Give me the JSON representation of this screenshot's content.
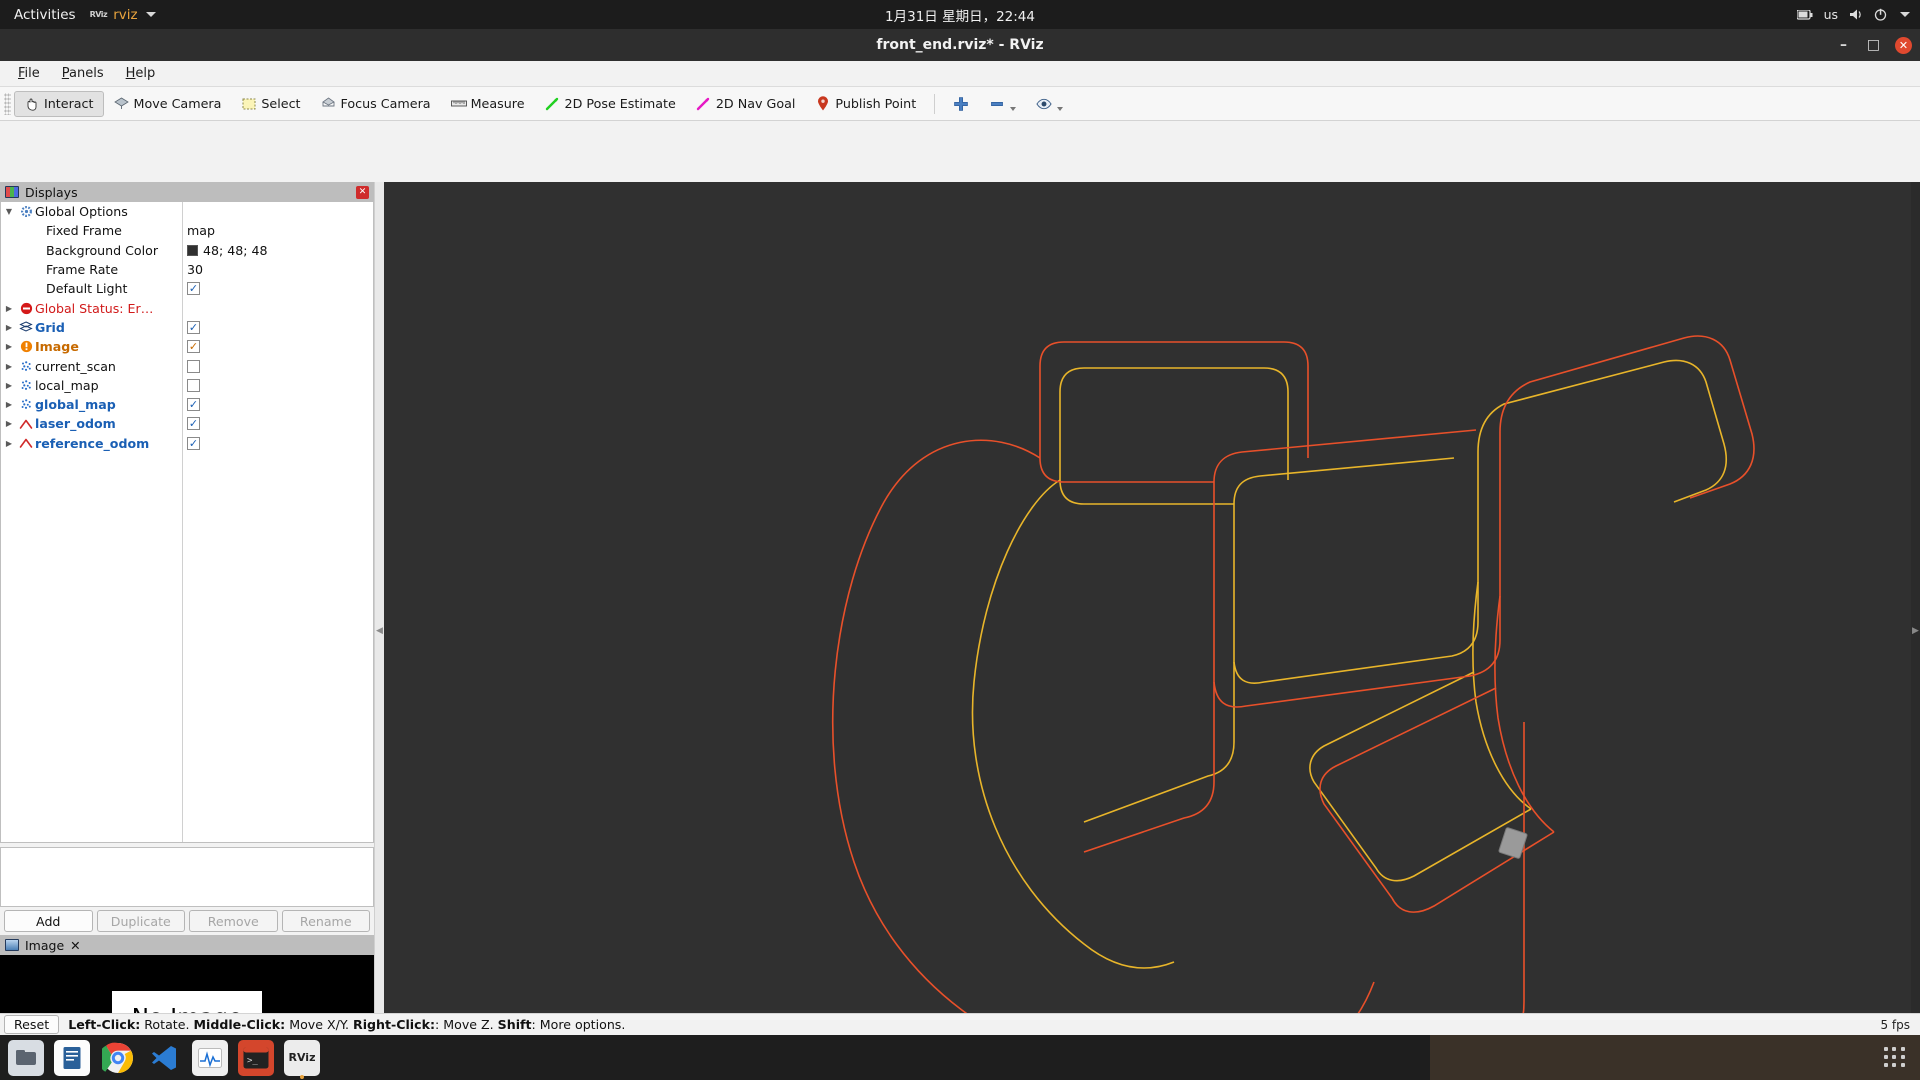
{
  "gnome": {
    "activities": "Activities",
    "app_icon_text": "RViz",
    "app_name": "rviz",
    "datetime": "1月31日 星期日，22:44",
    "keyboard_layout": "us",
    "icons": [
      "battery-icon",
      "keyboard-icon",
      "volume-icon",
      "power-icon",
      "chevron-down-icon"
    ]
  },
  "window": {
    "title": "front_end.rviz* - RViz",
    "minimize": "–",
    "maximize": "□",
    "close": "✕"
  },
  "menubar": {
    "items": [
      {
        "label": "File",
        "accel": "F"
      },
      {
        "label": "Panels",
        "accel": "P"
      },
      {
        "label": "Help",
        "accel": "H"
      }
    ]
  },
  "toolbar": {
    "buttons": [
      {
        "label": "Interact",
        "icon": "hand-icon",
        "active": true
      },
      {
        "label": "Move Camera",
        "icon": "move-camera-icon",
        "active": false
      },
      {
        "label": "Select",
        "icon": "select-rect-icon",
        "active": false
      },
      {
        "label": "Focus Camera",
        "icon": "focus-camera-icon",
        "active": false
      },
      {
        "label": "Measure",
        "icon": "ruler-icon",
        "active": false
      },
      {
        "label": "2D Pose Estimate",
        "icon": "green-arrow-icon",
        "active": false
      },
      {
        "label": "2D Nav Goal",
        "icon": "magenta-arrow-icon",
        "active": false
      },
      {
        "label": "Publish Point",
        "icon": "map-pin-icon",
        "active": false
      }
    ],
    "extra_icons": [
      {
        "name": "plus-icon",
        "glyph": "✚"
      },
      {
        "name": "minus-icon",
        "glyph": "➖"
      },
      {
        "name": "eye-icon",
        "glyph": "👁"
      }
    ]
  },
  "displays_panel": {
    "title": "Displays",
    "close_glyph": "✕",
    "tree": [
      {
        "label": "Global Options",
        "icon": "gear-icon",
        "style": "plain",
        "arrow": "down",
        "indent": 0,
        "value": "",
        "check": null
      },
      {
        "label": "Fixed Frame",
        "icon": "",
        "style": "plain",
        "arrow": "",
        "indent": 1,
        "value": "map",
        "check": null
      },
      {
        "label": "Background Color",
        "icon": "",
        "style": "plain",
        "arrow": "",
        "indent": 1,
        "value": "48; 48; 48",
        "swatch": "#303030",
        "check": null
      },
      {
        "label": "Frame Rate",
        "icon": "",
        "style": "plain",
        "arrow": "",
        "indent": 1,
        "value": "30",
        "check": null
      },
      {
        "label": "Default Light",
        "icon": "",
        "style": "plain",
        "arrow": "",
        "indent": 1,
        "value": "",
        "check": true,
        "check_color": "blue"
      },
      {
        "label": "Global Status: Er…",
        "icon": "error-icon",
        "style": "red",
        "arrow": "right",
        "indent": 0,
        "value": "",
        "check": null
      },
      {
        "label": "Grid",
        "icon": "grid-icon",
        "style": "blue",
        "arrow": "right",
        "indent": 0,
        "value": "",
        "check": true,
        "check_color": "blue"
      },
      {
        "label": "Image",
        "icon": "warning-icon",
        "style": "orange",
        "arrow": "right",
        "indent": 0,
        "value": "",
        "check": true,
        "check_color": "orange"
      },
      {
        "label": "current_scan",
        "icon": "pointcloud-icon",
        "style": "plain",
        "arrow": "right",
        "indent": 0,
        "value": "",
        "check": false
      },
      {
        "label": "local_map",
        "icon": "pointcloud-icon",
        "style": "plain",
        "arrow": "right",
        "indent": 0,
        "value": "",
        "check": false
      },
      {
        "label": "global_map",
        "icon": "pointcloud-icon",
        "style": "blue",
        "arrow": "right",
        "indent": 0,
        "value": "",
        "check": true,
        "check_color": "blue"
      },
      {
        "label": "laser_odom",
        "icon": "path-icon",
        "style": "blue",
        "arrow": "right",
        "indent": 0,
        "value": "",
        "check": true,
        "check_color": "blue"
      },
      {
        "label": "reference_odom",
        "icon": "path-icon",
        "style": "blue",
        "arrow": "right",
        "indent": 0,
        "value": "",
        "check": true,
        "check_color": "blue"
      }
    ],
    "buttons": [
      {
        "label": "Add",
        "enabled": true
      },
      {
        "label": "Duplicate",
        "enabled": false
      },
      {
        "label": "Remove",
        "enabled": false
      },
      {
        "label": "Rename",
        "enabled": false
      }
    ]
  },
  "image_panel": {
    "title": "Image",
    "close_glyph": "✕",
    "placeholder": "No Image"
  },
  "statusbar": {
    "reset_label": "Reset",
    "hint_segments": [
      {
        "text": "Left-Click:",
        "bold": true
      },
      {
        "text": " Rotate. ",
        "bold": false
      },
      {
        "text": "Middle-Click:",
        "bold": true
      },
      {
        "text": " Move X/Y. ",
        "bold": false
      },
      {
        "text": "Right-Click:",
        "bold": true
      },
      {
        "text": ": Move Z. ",
        "bold": false
      },
      {
        "text": "Shift",
        "bold": true
      },
      {
        "text": ": More options.",
        "bold": false
      }
    ],
    "fps": "5 fps"
  },
  "dock": {
    "items": [
      {
        "name": "files-icon",
        "glyph": "🗀",
        "color": "#cfd8e3",
        "running": false
      },
      {
        "name": "libreoffice-writer-icon",
        "glyph": "▤",
        "color": "#2a6099",
        "running": false
      },
      {
        "name": "chrome-icon",
        "glyph": "●",
        "color": "#4285f4",
        "running": false
      },
      {
        "name": "vscode-icon",
        "glyph": "❮❯",
        "color": "#2b7cd3",
        "running": false
      },
      {
        "name": "monitor-icon",
        "glyph": "∿",
        "color": "#e8e8e8",
        "running": false
      },
      {
        "name": "terminal-icon",
        "glyph": "⌫",
        "color": "#d4462c",
        "running": false
      },
      {
        "name": "rviz-icon",
        "glyph": "RViz",
        "color": "#e8e8e8",
        "running": true
      }
    ],
    "show_apps": "show-applications-icon"
  },
  "view3d": {
    "background": "#303030",
    "paths": [
      {
        "name": "laser_odom-trajectory",
        "color": "#e8502a"
      },
      {
        "name": "reference_odom-trajectory",
        "color": "#e8b52a"
      }
    ],
    "robot_marker": {
      "name": "robot-marker",
      "color": "#9a9a9a"
    }
  }
}
